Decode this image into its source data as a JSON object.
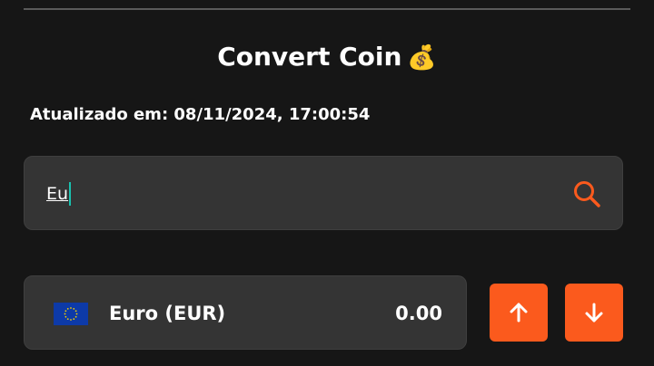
{
  "header": {
    "title": "Convert Coin",
    "title_emoji": "💰"
  },
  "updated_label": "Atualizado em: 08/11/2024, 17:00:54",
  "search": {
    "value": "Eu",
    "icon": "search-icon"
  },
  "currency_item": {
    "flag_icon": "eu-flag-icon",
    "name": "Euro (EUR)",
    "value": "0.00"
  },
  "actions": {
    "up_icon": "arrow-up-icon",
    "down_icon": "arrow-down-icon"
  },
  "colors": {
    "background": "#161616",
    "card": "#343434",
    "accent": "#fb5a1d",
    "caret": "#19c2b0"
  }
}
